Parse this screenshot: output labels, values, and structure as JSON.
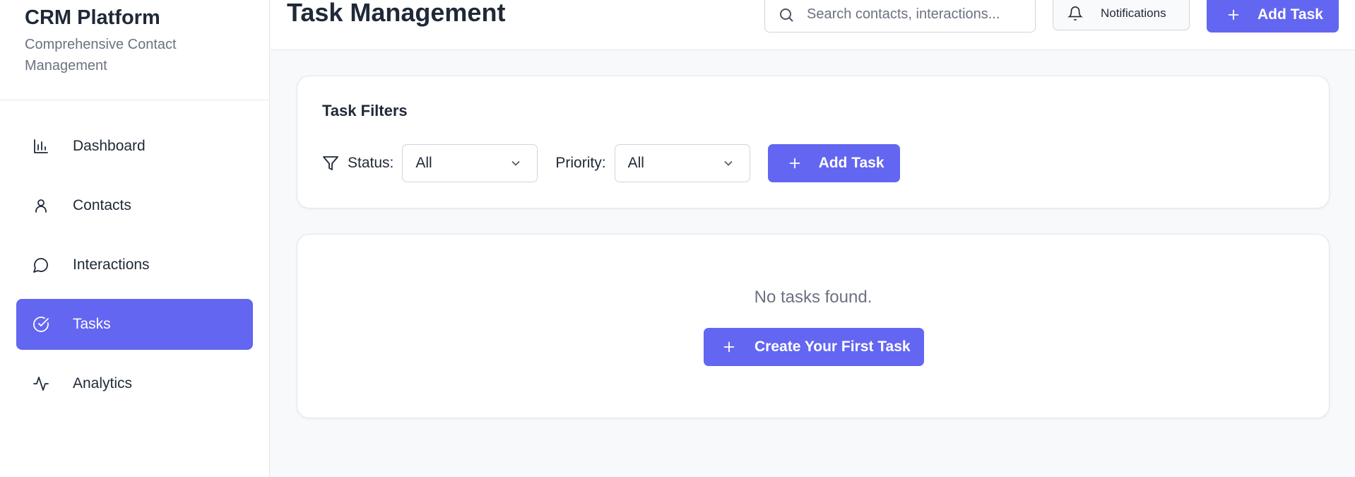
{
  "brand": {
    "title": "CRM Platform",
    "subtitle": "Comprehensive Contact Management"
  },
  "sidebar": {
    "items": [
      {
        "label": "Dashboard",
        "icon": "bar-chart-icon",
        "active": false
      },
      {
        "label": "Contacts",
        "icon": "user-icon",
        "active": false
      },
      {
        "label": "Interactions",
        "icon": "message-circle-icon",
        "active": false
      },
      {
        "label": "Tasks",
        "icon": "check-circle-icon",
        "active": true
      },
      {
        "label": "Analytics",
        "icon": "activity-icon",
        "active": false
      }
    ]
  },
  "header": {
    "title": "Task Management",
    "search_placeholder": "Search contacts, interactions...",
    "notifications_label": "Notifications",
    "add_task_label": "Add Task"
  },
  "filters": {
    "title": "Task Filters",
    "status_label": "Status:",
    "status_value": "All",
    "priority_label": "Priority:",
    "priority_value": "All",
    "add_task_label": "Add Task"
  },
  "empty_state": {
    "message": "No tasks found.",
    "button_label": "Create Your First Task"
  },
  "colors": {
    "accent": "#6366f1",
    "text": "#1f2937",
    "muted": "#6b7280",
    "border": "#e5e7eb",
    "background": "#f8f9fb"
  }
}
